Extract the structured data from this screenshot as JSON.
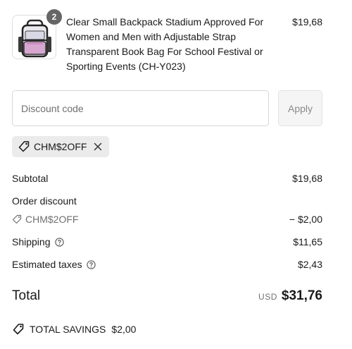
{
  "product": {
    "quantity": "2",
    "name": "Clear Small Backpack Stadium Approved For Women and Men with Adjustable Strap Transparent Book Bag For School Festival or Sporting Events (CH-Y023)",
    "price": "$19,68",
    "thumbnail_icon": "backpack-image"
  },
  "discount": {
    "placeholder": "Discount code",
    "apply_label": "Apply",
    "applied_code": "CHM$2OFF"
  },
  "summary": {
    "subtotal_label": "Subtotal",
    "subtotal_value": "$19,68",
    "order_discount_label": "Order discount",
    "order_discount_code": "CHM$2OFF",
    "order_discount_value": "− $2,00",
    "shipping_label": "Shipping",
    "shipping_value": "$11,65",
    "taxes_label": "Estimated taxes",
    "taxes_value": "$2,43",
    "total_label": "Total",
    "currency": "USD",
    "total_value": "$31,76",
    "savings_label": "TOTAL SAVINGS",
    "savings_value": "$2,00"
  }
}
